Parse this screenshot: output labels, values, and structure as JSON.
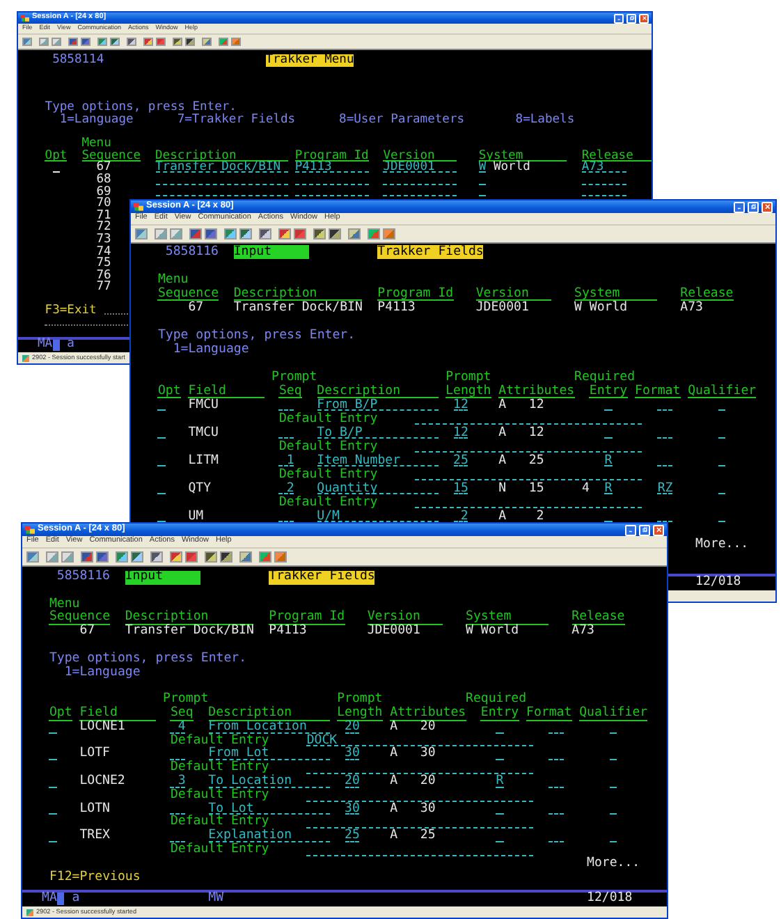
{
  "windows": [
    {
      "kind": "menu",
      "title": "Session A - [24 x 80]",
      "menu_bar": [
        "File",
        "Edit",
        "View",
        "Communication",
        "Actions",
        "Window",
        "Help"
      ],
      "screen": {
        "job_number": "5858114",
        "heading": "Trakker Menu",
        "instruction": "Type options, press Enter.",
        "options": [
          "1=Language",
          "7=Trakker Fields",
          "8=User Parameters",
          "8=Labels"
        ],
        "column_group": "Menu",
        "columns": [
          "Opt",
          "Sequence",
          "Description",
          "Program Id",
          "Version",
          "System",
          "Release"
        ],
        "rows": [
          {
            "sequence": "67",
            "has_option": true,
            "blank_fields": false,
            "description": "Transfer Dock/BIN",
            "program_id": "P4113",
            "version": "JDE0001",
            "system_code": "W",
            "system_name": "World",
            "release": "A73"
          },
          {
            "sequence": "68",
            "has_option": false,
            "blank_fields": true
          },
          {
            "sequence": "69",
            "has_option": false,
            "blank_fields": true
          },
          {
            "sequence": "70",
            "has_option": false,
            "blank_fields": false
          },
          {
            "sequence": "71",
            "has_option": false,
            "blank_fields": false
          },
          {
            "sequence": "72",
            "has_option": false,
            "blank_fields": false
          },
          {
            "sequence": "73",
            "has_option": false,
            "blank_fields": false
          },
          {
            "sequence": "74",
            "has_option": false,
            "blank_fields": false
          },
          {
            "sequence": "75",
            "has_option": false,
            "blank_fields": false
          },
          {
            "sequence": "76",
            "has_option": false,
            "blank_fields": false
          },
          {
            "sequence": "77",
            "has_option": false,
            "blank_fields": false
          }
        ],
        "function_keys": "F3=Exit"
      },
      "status": {
        "mode": "MA",
        "field": "a"
      },
      "message": "2902 - Session successfully start"
    },
    {
      "kind": "fields",
      "title": "Session A - [24 x 80]",
      "menu_bar": [
        "File",
        "Edit",
        "View",
        "Communication",
        "Actions",
        "Window",
        "Help"
      ],
      "screen": {
        "job_number": "5858116",
        "mode": "Input",
        "heading": "Trakker Fields",
        "group_label": "Menu",
        "header_columns": [
          "Sequence",
          "Description",
          "Program Id",
          "Version",
          "System",
          "Release"
        ],
        "header_values": [
          "67",
          "Transfer Dock/BIN",
          "P4113",
          "JDE0001",
          "W World",
          "A73"
        ],
        "instruction": "Type options, press Enter.",
        "options": [
          "1=Language"
        ],
        "columns": [
          {
            "label": "Opt"
          },
          {
            "label": "Field"
          },
          {
            "top": "Prompt",
            "label": "Seq"
          },
          {
            "label": "Description"
          },
          {
            "top": "Prompt",
            "label": "Length"
          },
          {
            "label": "Attributes"
          },
          {
            "top": "Required",
            "label": "Entry"
          },
          {
            "label": "Format"
          },
          {
            "label": "Qualifier"
          }
        ],
        "rows": [
          {
            "field": "FMCU",
            "description": "From B/P",
            "prompt_length": "12",
            "type": "A",
            "size": "12",
            "default_label": "Default Entry"
          },
          {
            "field": "TMCU",
            "description": "To B/P",
            "prompt_length": "12",
            "type": "A",
            "size": "12",
            "default_label": "Default Entry"
          },
          {
            "field": "LITM",
            "prompt_seq": "1",
            "description": "Item Number",
            "prompt_length": "25",
            "type": "A",
            "size": "25",
            "required": "R",
            "default_label": "Default Entry"
          },
          {
            "field": "QTY",
            "prompt_seq": "2",
            "description": "Quantity",
            "prompt_length": "15",
            "type": "N",
            "size": "15",
            "decimals": "4",
            "required": "R",
            "format": "RZ",
            "default_label": "Default Entry"
          },
          {
            "field": "UM",
            "description": "U/M",
            "prompt_length": "2",
            "type": "A",
            "size": "2"
          }
        ],
        "more": "More..."
      },
      "status": {
        "position": "12/018"
      }
    },
    {
      "kind": "fields",
      "title": "Session A - [24 x 80]",
      "menu_bar": [
        "File",
        "Edit",
        "View",
        "Communication",
        "Actions",
        "Window",
        "Help"
      ],
      "screen": {
        "job_number": "5858116",
        "mode": "Input",
        "heading": "Trakker Fields",
        "group_label": "Menu",
        "header_columns": [
          "Sequence",
          "Description",
          "Program Id",
          "Version",
          "System",
          "Release"
        ],
        "header_values": [
          "67",
          "Transfer Dock/BIN",
          "P4113",
          "JDE0001",
          "W World",
          "A73"
        ],
        "instruction": "Type options, press Enter.",
        "options": [
          "1=Language"
        ],
        "columns": [
          {
            "label": "Opt"
          },
          {
            "label": "Field"
          },
          {
            "top": "Prompt",
            "label": "Seq"
          },
          {
            "label": "Description"
          },
          {
            "top": "Prompt",
            "label": "Length"
          },
          {
            "label": "Attributes"
          },
          {
            "top": "Required",
            "label": "Entry"
          },
          {
            "label": "Format"
          },
          {
            "label": "Qualifier"
          }
        ],
        "rows": [
          {
            "field": "LOCNE1",
            "prompt_seq": "4",
            "description": "From Location",
            "prompt_length": "20",
            "type": "A",
            "size": "20",
            "default_label": "Default Entry",
            "default_value": "DOCK"
          },
          {
            "field": "LOTF",
            "description": "From Lot",
            "prompt_length": "30",
            "type": "A",
            "size": "30",
            "default_label": "Default Entry"
          },
          {
            "field": "LOCNE2",
            "prompt_seq": "3",
            "description": "To Location",
            "prompt_length": "20",
            "type": "A",
            "size": "20",
            "required": "R",
            "default_label": "Default Entry"
          },
          {
            "field": "LOTN",
            "description": "To Lot",
            "prompt_length": "30",
            "type": "A",
            "size": "30",
            "default_label": "Default Entry"
          },
          {
            "field": "TREX",
            "description": "Explanation",
            "prompt_length": "25",
            "type": "A",
            "size": "25",
            "default_label": "Default Entry"
          }
        ],
        "more": "More...",
        "function_keys": "F12=Previous"
      },
      "status": {
        "mode": "MA",
        "field": "a",
        "indicator": "MW",
        "position": "12/018"
      },
      "message": "2902 - Session successfully started"
    }
  ]
}
